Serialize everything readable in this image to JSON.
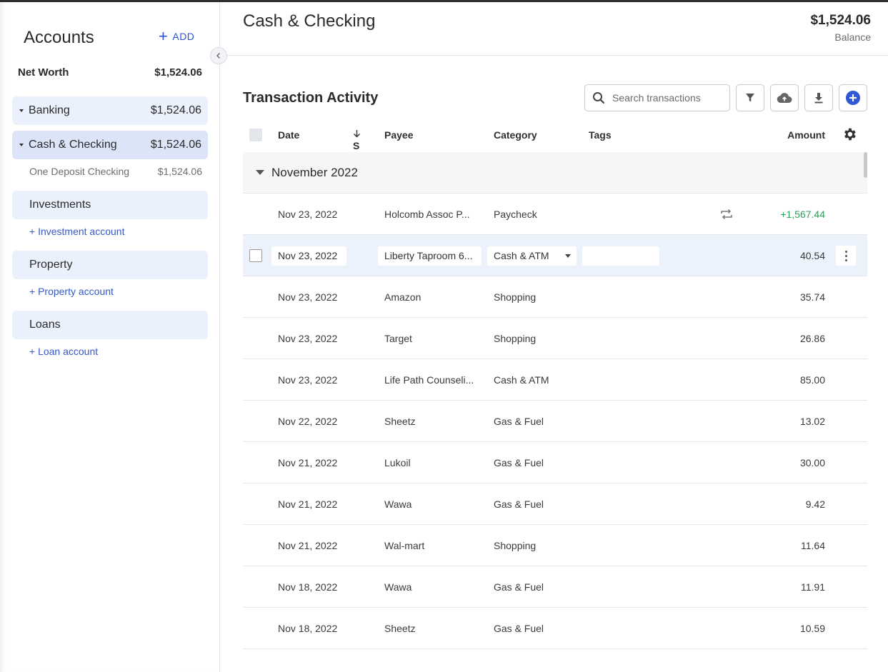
{
  "sidebar": {
    "title": "Accounts",
    "add_label": "ADD",
    "net_worth": {
      "label": "Net Worth",
      "value": "$1,524.06"
    },
    "banking": {
      "label": "Banking",
      "value": "$1,524.06"
    },
    "cash_checking": {
      "label": "Cash & Checking",
      "value": "$1,524.06"
    },
    "sub_account": {
      "label": "One Deposit Checking",
      "value": "$1,524.06"
    },
    "investments": {
      "label": "Investments",
      "add_link": "+ Investment account"
    },
    "property": {
      "label": "Property",
      "add_link": "+ Property account"
    },
    "loans": {
      "label": "Loans",
      "add_link": "+ Loan account"
    }
  },
  "header": {
    "title": "Cash & Checking",
    "balance_value": "$1,524.06",
    "balance_label": "Balance"
  },
  "activity": {
    "title": "Transaction Activity",
    "search_placeholder": "Search transactions",
    "columns": {
      "date": "Date",
      "status": "S",
      "payee": "Payee",
      "category": "Category",
      "tags": "Tags",
      "amount": "Amount"
    },
    "month_group": "November 2022",
    "transactions": [
      {
        "date": "Nov 23, 2022",
        "payee": "Holcomb Assoc P...",
        "category": "Paycheck",
        "amount": "+1,567.44"
      },
      {
        "date": "Nov 23, 2022",
        "payee": "Liberty Taproom 6...",
        "category": "Cash & ATM",
        "amount": "40.54"
      },
      {
        "date": "Nov 23, 2022",
        "payee": "Amazon",
        "category": "Shopping",
        "amount": "35.74"
      },
      {
        "date": "Nov 23, 2022",
        "payee": "Target",
        "category": "Shopping",
        "amount": "26.86"
      },
      {
        "date": "Nov 23, 2022",
        "payee": "Life Path Counseli...",
        "category": "Cash & ATM",
        "amount": "85.00"
      },
      {
        "date": "Nov 22, 2022",
        "payee": "Sheetz",
        "category": "Gas & Fuel",
        "amount": "13.02"
      },
      {
        "date": "Nov 21, 2022",
        "payee": "Lukoil",
        "category": "Gas & Fuel",
        "amount": "30.00"
      },
      {
        "date": "Nov 21, 2022",
        "payee": "Wawa",
        "category": "Gas & Fuel",
        "amount": "9.42"
      },
      {
        "date": "Nov 21, 2022",
        "payee": "Wal-mart",
        "category": "Shopping",
        "amount": "11.64"
      },
      {
        "date": "Nov 18, 2022",
        "payee": "Wawa",
        "category": "Gas & Fuel",
        "amount": "11.91"
      },
      {
        "date": "Nov 18, 2022",
        "payee": "Sheetz",
        "category": "Gas & Fuel",
        "amount": "10.59"
      }
    ]
  },
  "colors": {
    "accent": "#2a53d3",
    "positive": "#2e9e55",
    "group_bg": "#ebf1fc",
    "selected_bg": "#dce5f8"
  },
  "icons": [
    "plus-icon",
    "chevron-left-icon",
    "search-icon",
    "filter-icon",
    "cloud-upload-icon",
    "download-icon",
    "add-circle-icon",
    "sort-down-arrow-icon",
    "gear-icon",
    "repeat-icon",
    "more-vertical-icon"
  ]
}
